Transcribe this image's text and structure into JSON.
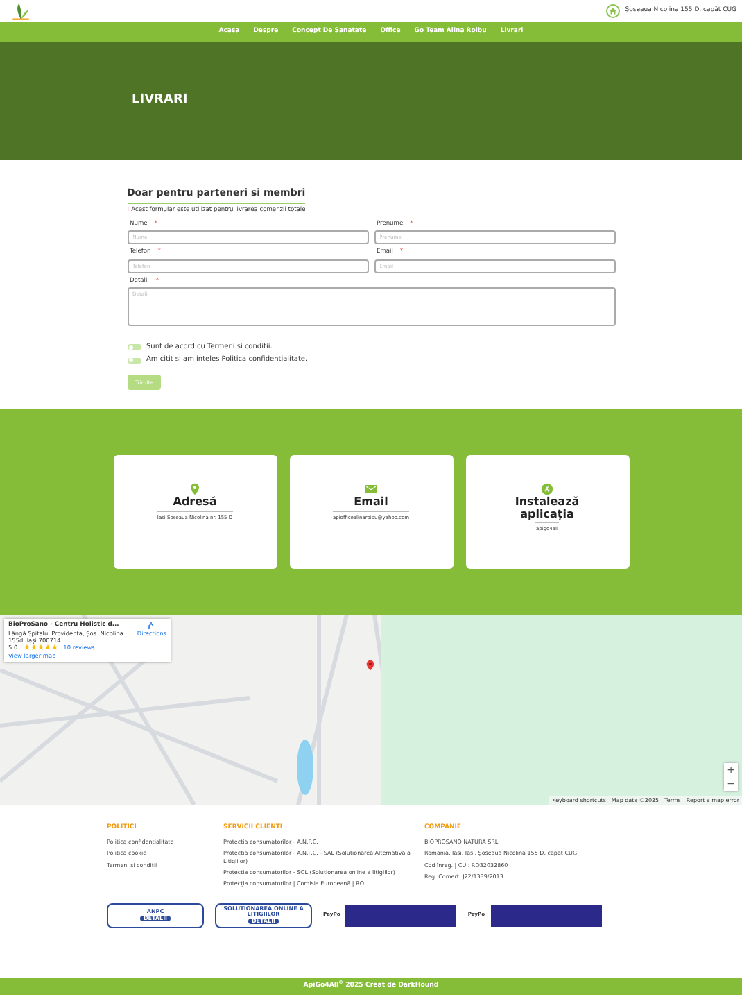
{
  "header": {
    "address": "Șoseaua Nicolina 155 D, capăt CUG"
  },
  "nav": {
    "items": [
      "Acasa",
      "Despre",
      "Concept De Sanatate",
      "Office",
      "Go Team Alina Roibu",
      "Livrari"
    ]
  },
  "hero": {
    "title": "LIVRARI"
  },
  "form": {
    "title": "Doar pentru parteneri si membri",
    "note_mark": "!",
    "note": "Acest formular este utilizat pentru livrarea comenzii totale",
    "fields": [
      {
        "kind": "input",
        "label": "Nume",
        "required_mark": "*",
        "placeholder": "Nume"
      },
      {
        "kind": "input",
        "label": "Prenume",
        "required_mark": "*",
        "placeholder": "Prenume"
      },
      {
        "kind": "input",
        "label": "Telefon",
        "required_mark": "*",
        "placeholder": "Telefon"
      },
      {
        "kind": "input",
        "label": "Email",
        "required_mark": "*",
        "placeholder": "Email"
      },
      {
        "kind": "textarea",
        "label": "Detalii",
        "required_mark": "*",
        "placeholder": "Detalii"
      }
    ],
    "toggles": [
      {
        "label": "Sunt de acord cu Termeni si conditii.",
        "on": false
      },
      {
        "label": "Am citit si am inteles Politica confidentialitate.",
        "on": false
      }
    ],
    "submit": {
      "label": "Trimite",
      "disabled": true
    }
  },
  "contact_cards": [
    {
      "kind": "pin",
      "title": "Adresă",
      "text": "Iasi Soseaua Nicolina nr. 155 D"
    },
    {
      "kind": "mail",
      "title": "Email",
      "text": "apiofficealinaroibu@yahoo.com"
    },
    {
      "kind": "app",
      "title": "Instalează aplicația",
      "text": "apigo4all"
    }
  ],
  "map": {
    "place_card": {
      "title": "BioProSano - Centru Holistic d...",
      "address": "Lângă Spitalul Providenta, Șos. Nicolina 155d, Iași 700714",
      "rating": "5.0",
      "stars": 5,
      "reviews": "10 reviews",
      "larger_map": "View larger map",
      "directions": "Directions"
    },
    "zoom_in": "+",
    "zoom_out": "−",
    "attribution": [
      "Keyboard shortcuts",
      "Map data ©2025",
      "Terms",
      "Report a map error"
    ]
  },
  "footer": {
    "columns": [
      {
        "heading": "POLITICI",
        "links": [
          "Politica confidentialitate",
          "Politica cookie",
          "Termeni si conditii"
        ]
      },
      {
        "heading": "SERVICII CLIENTI",
        "links": [
          "Protectia consumatorilor - A.N.P.C.",
          "Protectia consumatorilor - A.N.P.C. - SAL (Solutionarea Alternativa a Litigiilor)",
          "Protectia consumatorilor - SOL (Solutionarea online a litigiilor)",
          "Protecția consumatorilor | Comisia Europeană | RO"
        ]
      },
      {
        "heading": "COMPANIE",
        "links": [
          "BIOPROSANO NATURA SRL",
          "Romania, Iasi, Iasi, Șoseaua Nicolina 155 D, capăt CUG",
          "Cod înreg. | CUI: RO32032860",
          "Reg. Comert: J22/1339/2013"
        ]
      }
    ],
    "badges": [
      {
        "kind": "anpc",
        "title": "ANPC",
        "button": "DETALII"
      },
      {
        "kind": "sol",
        "title": "SOLUTIONAREA ONLINE A LITIGIILOR",
        "button": "DETALII"
      },
      {
        "kind": "paypo",
        "title": "PayPo"
      },
      {
        "kind": "paypo",
        "title": "PayPo"
      }
    ],
    "copyright": "ApiGo4All$^{®}$ 2025 Creat de DarkHound"
  }
}
